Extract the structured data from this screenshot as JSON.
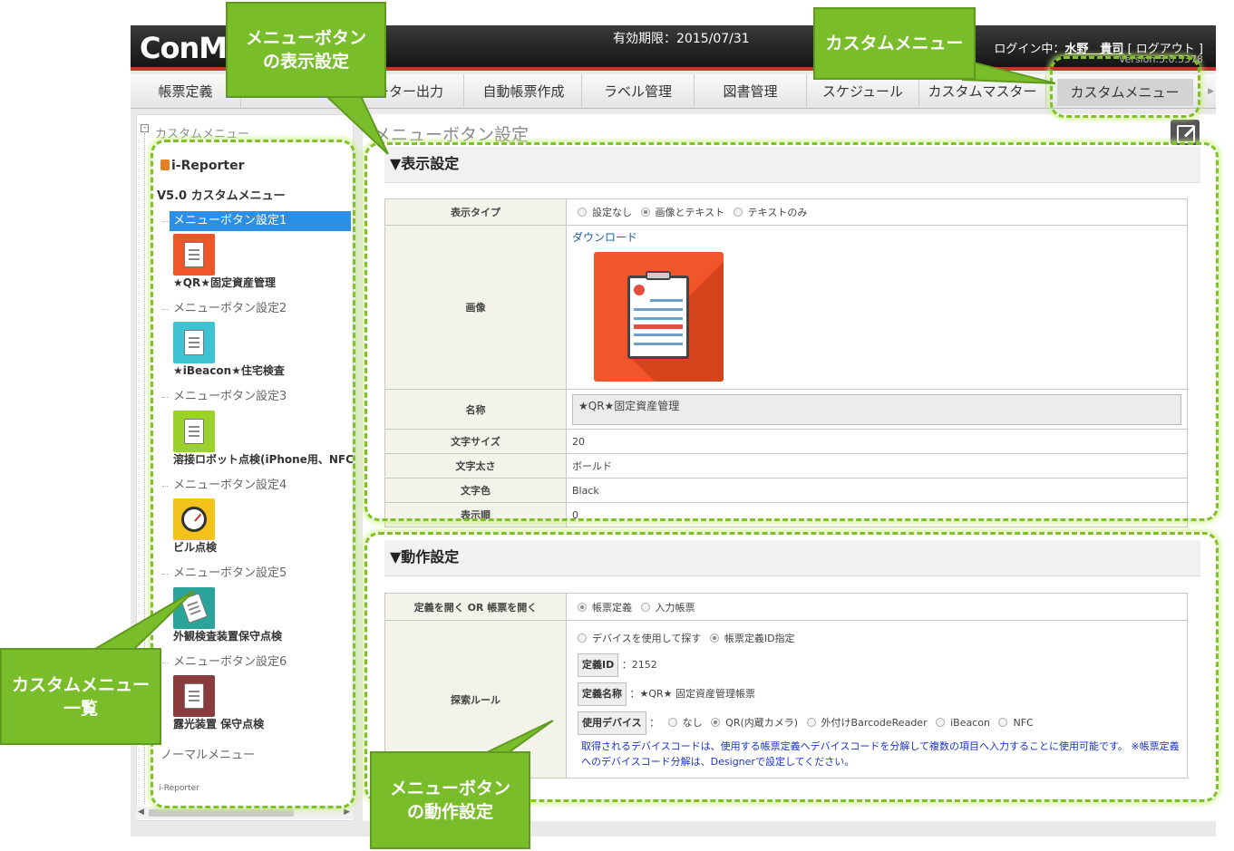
{
  "header": {
    "logo": "ConMa",
    "expiry": "有効期限：2015/07/31",
    "login_prefix": "ログイン中：",
    "user": "水野　貴司",
    "logout": "[ ログアウト ]",
    "version": "Version:5.0.5378"
  },
  "nav": {
    "tabs": [
      "帳票定義",
      "ーター出力",
      "自動帳票作成",
      "ラベル管理",
      "図書管理",
      "スケジュール",
      "カスタムマスター",
      "カスタムメニュー"
    ],
    "active": "カスタムメニュー"
  },
  "sidebar": {
    "root": "カスタムメニュー",
    "brand": "i-Reporter",
    "group": "V5.0 カスタムメニュー",
    "items": [
      {
        "setting": "メニューボタン設定1",
        "name": "★QR★固定資産管理",
        "color": "#f0562a"
      },
      {
        "setting": "メニューボタン設定2",
        "name": "★iBeacon★住宅検査",
        "color": "#3ec3d3"
      },
      {
        "setting": "メニューボタン設定3",
        "name": "溶接ロボット点検(iPhone用、NFC",
        "color": "#9ad22a"
      },
      {
        "setting": "メニューボタン設定4",
        "name": "ビル点検",
        "color": "#f3c31c"
      },
      {
        "setting": "メニューボタン設定5",
        "name": "外観検査装置保守点検",
        "color": "#2aa39a"
      },
      {
        "setting": "メニューボタン設定6",
        "name": "露光装置 保守点検",
        "color": "#8a3b3b"
      }
    ],
    "normal_menu": "ノーマルメニュー",
    "footer_logo": "i-Reporter"
  },
  "main": {
    "title": "メニューボタン設定",
    "display": {
      "heading": "▼表示設定",
      "type_label": "表示タイプ",
      "type_options": [
        "設定なし",
        "画像とテキスト",
        "テキストのみ"
      ],
      "type_selected": "画像とテキスト",
      "image_label": "画像",
      "download": "ダウンロード",
      "name_label": "名称",
      "name_value": "★QR★固定資産管理",
      "fontsize_label": "文字サイズ",
      "fontsize_value": "20",
      "weight_label": "文字太さ",
      "weight_value": "ボールド",
      "color_label": "文字色",
      "color_value": "Black",
      "order_label": "表示順",
      "order_value": "0"
    },
    "action": {
      "heading": "▼動作設定",
      "open_label": "定義を開く OR 帳票を開く",
      "open_options": [
        "帳票定義",
        "入力帳票"
      ],
      "open_selected": "帳票定義",
      "search_label": "探索ルール",
      "search_options": [
        "デバイスを使用して探す",
        "帳票定義ID指定"
      ],
      "search_selected": "帳票定義ID指定",
      "def_id_tag": "定義ID",
      "def_id_value": "：2152",
      "def_name_tag": "定義名称",
      "def_name_value": "：★QR★ 固定資産管理帳票",
      "device_tag": "使用デバイス",
      "device_sep": "：",
      "device_options": [
        "なし",
        "QR(内蔵カメラ)",
        "外付けBarcodeReader",
        "iBeacon",
        "NFC"
      ],
      "device_selected": "QR(内蔵カメラ)",
      "note": "取得されるデバイスコードは、使用する帳票定義へデバイスコードを分解して複数の項目へ入力することに使用可能です。 ※帳票定義へのデバイスコード分解は、Designerで設定してください。"
    }
  },
  "annotations": {
    "button_display": "メニューボタン\nの表示設定",
    "custom_menu": "カスタムメニュー",
    "custom_menu_list": "カスタムメニュー\n一覧",
    "button_action": "メニューボタン\nの動作設定"
  },
  "colors": {
    "accent": "#7ec225",
    "selected": "#2b8fe8",
    "header_bar": "#c0392b"
  }
}
